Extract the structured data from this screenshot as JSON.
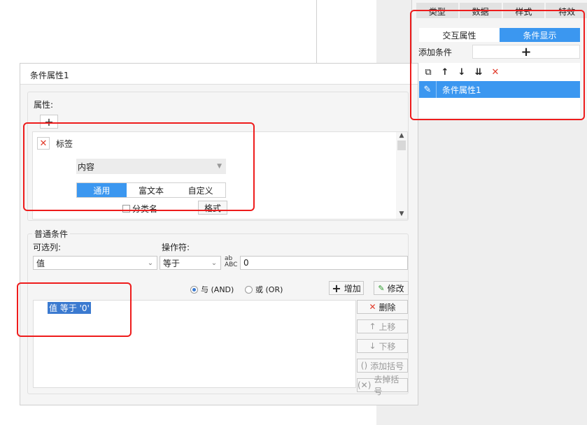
{
  "right_panel": {
    "tabs": [
      "类型",
      "数据",
      "样式",
      "特效"
    ],
    "sub_tabs": [
      {
        "label": "交互属性",
        "active": false
      },
      {
        "label": "条件显示",
        "active": true
      }
    ],
    "add_condition_label": "添加条件",
    "add_symbol": "+",
    "toolbar_icons": [
      "copy-icon",
      "arrow-up-icon",
      "arrow-down-icon",
      "move-bottom-icon",
      "delete-icon"
    ],
    "list_item": "条件属性1"
  },
  "dialog": {
    "title": "条件属性1",
    "attribute_label": "属性:",
    "plus_symbol": "+",
    "tag_label": "标签",
    "content_select": "内容",
    "modes": [
      "通用",
      "富文本",
      "自定义"
    ],
    "category_checkbox_label": "分类名",
    "format_button": "格式",
    "general_condition_legend": "普通条件",
    "optional_column_label": "可选列:",
    "operator_label": "操作符:",
    "column_value": "值",
    "operator_value": "等于",
    "condition_value": "0",
    "and_label": "与 (AND)",
    "or_label": "或 (OR)",
    "add_button": "增加",
    "modify_button": "修改",
    "condition_text": "值 等于 '0'",
    "delete_button": "删除",
    "move_up_button": "上移",
    "move_down_button": "下移",
    "add_bracket_button": "添加括号",
    "remove_bracket_button": "去掉括号"
  },
  "colors": {
    "accent": "#3b97f0",
    "highlight_red": "#ee1c1c",
    "delete_red": "#e13a2a"
  }
}
